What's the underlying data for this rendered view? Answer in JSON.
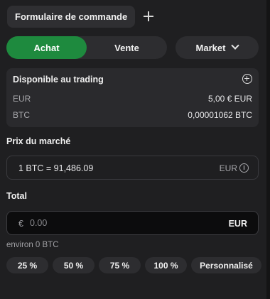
{
  "tabs": {
    "active_label": "Formulaire de commande",
    "add_icon": "plus-icon"
  },
  "order_side": {
    "buy_label": "Achat",
    "sell_label": "Vente",
    "selected": "Achat",
    "buy_color": "#1e8a3e"
  },
  "order_type": {
    "label": "Market",
    "icon": "chevron-down-icon"
  },
  "available": {
    "title": "Disponible au trading",
    "add_icon": "plus-circle-icon",
    "rows": [
      {
        "asset": "EUR",
        "amount": "5,00 € EUR"
      },
      {
        "asset": "BTC",
        "amount": "0,00001062 BTC"
      }
    ]
  },
  "market_price": {
    "label": "Prix du marché",
    "value": "1 BTC = 91,486.09",
    "unit": "EUR",
    "info_icon": "info-icon"
  },
  "total": {
    "label": "Total",
    "currency_symbol": "€",
    "placeholder": "0.00",
    "unit": "EUR",
    "approx": "environ 0 BTC"
  },
  "percentages": [
    "25 %",
    "50 %",
    "75 %",
    "100 %",
    "Personnalisé"
  ]
}
